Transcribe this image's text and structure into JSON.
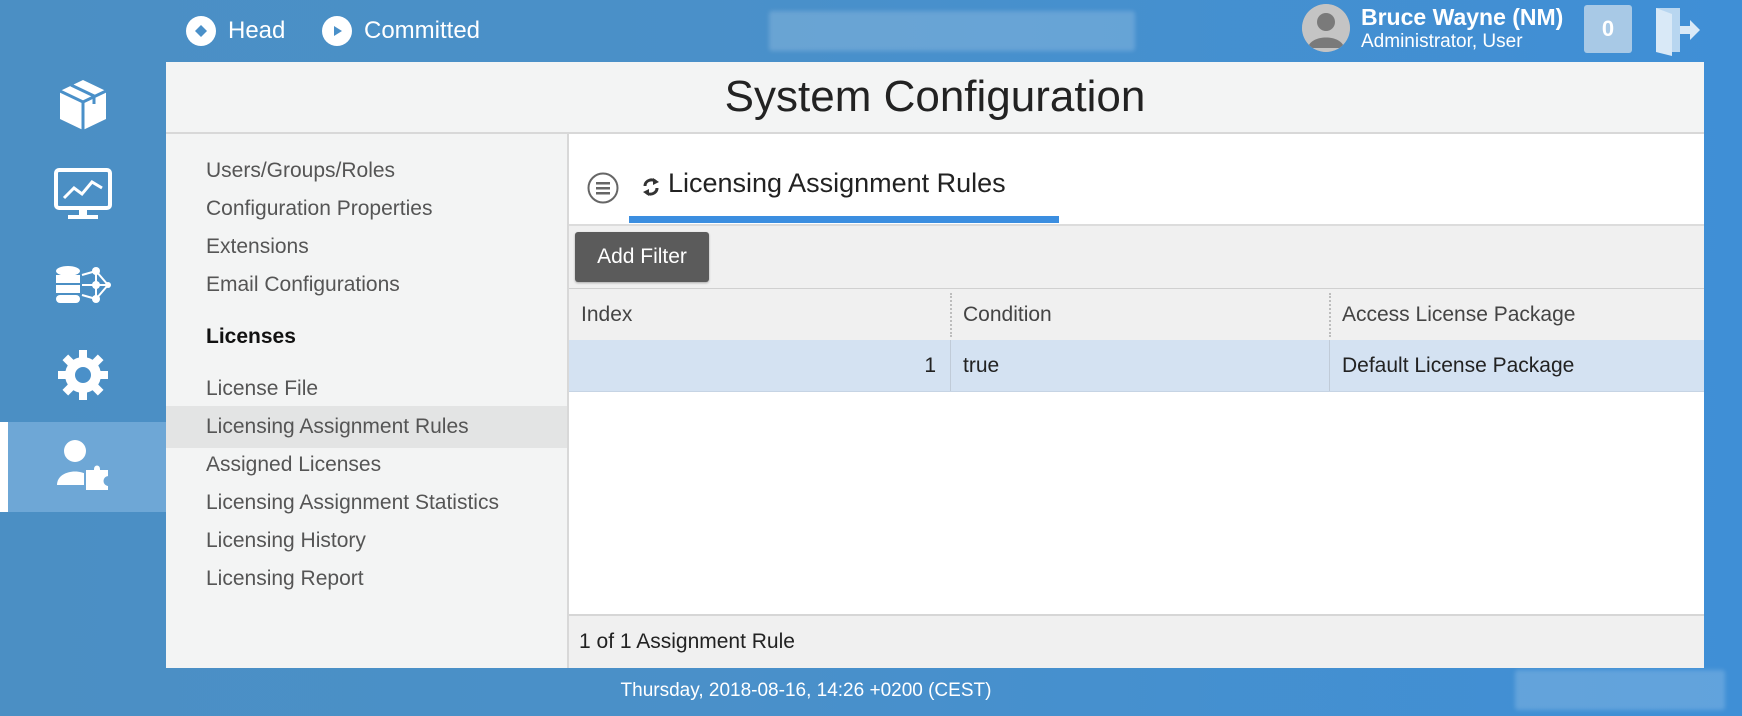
{
  "topbar": {
    "head_label": "Head",
    "committed_label": "Committed",
    "user_name": "Bruce Wayne (NM)",
    "user_role": "Administrator, User",
    "notification_count": "0"
  },
  "page_title": "System Configuration",
  "sidebar": {
    "items": [
      {
        "label": "Users/Groups/Roles"
      },
      {
        "label": "Configuration Properties"
      },
      {
        "label": "Extensions"
      },
      {
        "label": "Email Configurations"
      }
    ],
    "licenses_heading": "Licenses",
    "license_items": [
      {
        "label": "License File"
      },
      {
        "label": "Licensing Assignment Rules"
      },
      {
        "label": "Assigned Licenses"
      },
      {
        "label": "Licensing Assignment Statistics"
      },
      {
        "label": "Licensing History"
      },
      {
        "label": "Licensing Report"
      }
    ],
    "active_item": "Licensing Assignment Rules"
  },
  "content": {
    "tab_title": "Licensing Assignment Rules",
    "add_filter_label": "Add Filter",
    "columns": [
      "Index",
      "Condition",
      "Access License Package"
    ],
    "rows": [
      {
        "index": "1",
        "condition": "true",
        "package": "Default License Package"
      }
    ],
    "footer": "1 of 1 Assignment Rule"
  },
  "status_bar": {
    "datetime": "Thursday, 2018-08-16, 14:26 +0200 (CEST)"
  },
  "colors": {
    "accent": "#3b8ee0",
    "selected_row": "#d4e2f2",
    "button_dark": "#5b5b5b"
  }
}
